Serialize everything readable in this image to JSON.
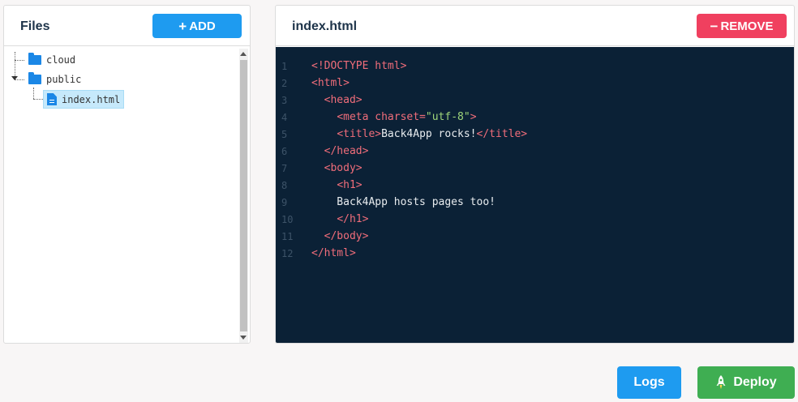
{
  "files_panel": {
    "title": "Files",
    "add_label": "ADD",
    "tree": [
      {
        "name": "cloud",
        "type": "folder"
      },
      {
        "name": "public",
        "type": "folder"
      },
      {
        "name": "index.html",
        "type": "file",
        "selected": true
      }
    ]
  },
  "editor": {
    "title": "index.html",
    "remove_label": "REMOVE",
    "lines": [
      {
        "n": "1",
        "parts": [
          [
            "tag",
            "<!DOCTYPE html>"
          ]
        ]
      },
      {
        "n": "2",
        "parts": [
          [
            "tag",
            "<html>"
          ]
        ]
      },
      {
        "n": "3",
        "parts": [
          [
            "txt",
            "  "
          ],
          [
            "tag",
            "<head>"
          ]
        ]
      },
      {
        "n": "4",
        "parts": [
          [
            "txt",
            "    "
          ],
          [
            "tag",
            "<meta charset="
          ],
          [
            "str",
            "\"utf-8\""
          ],
          [
            "tag",
            ">"
          ]
        ]
      },
      {
        "n": "5",
        "parts": [
          [
            "txt",
            "    "
          ],
          [
            "tag",
            "<title>"
          ],
          [
            "txt",
            "Back4App rocks!"
          ],
          [
            "tag",
            "</title>"
          ]
        ]
      },
      {
        "n": "6",
        "parts": [
          [
            "txt",
            "  "
          ],
          [
            "tag",
            "</head>"
          ]
        ]
      },
      {
        "n": "7",
        "parts": [
          [
            "txt",
            "  "
          ],
          [
            "tag",
            "<body>"
          ]
        ]
      },
      {
        "n": "8",
        "parts": [
          [
            "txt",
            "    "
          ],
          [
            "tag",
            "<h1>"
          ]
        ]
      },
      {
        "n": "9",
        "parts": [
          [
            "txt",
            "    Back4App hosts pages too!"
          ]
        ]
      },
      {
        "n": "10",
        "parts": [
          [
            "txt",
            "    "
          ],
          [
            "tag",
            "</h1>"
          ]
        ]
      },
      {
        "n": "11",
        "parts": [
          [
            "txt",
            "  "
          ],
          [
            "tag",
            "</body>"
          ]
        ]
      },
      {
        "n": "12",
        "parts": [
          [
            "tag",
            "</html>"
          ]
        ]
      }
    ]
  },
  "actions": {
    "logs_label": "Logs",
    "deploy_label": "Deploy"
  },
  "colors": {
    "primary": "#1e9bf0",
    "danger": "#f0405f",
    "success": "#3fae52",
    "editor_bg": "#0b2136"
  }
}
